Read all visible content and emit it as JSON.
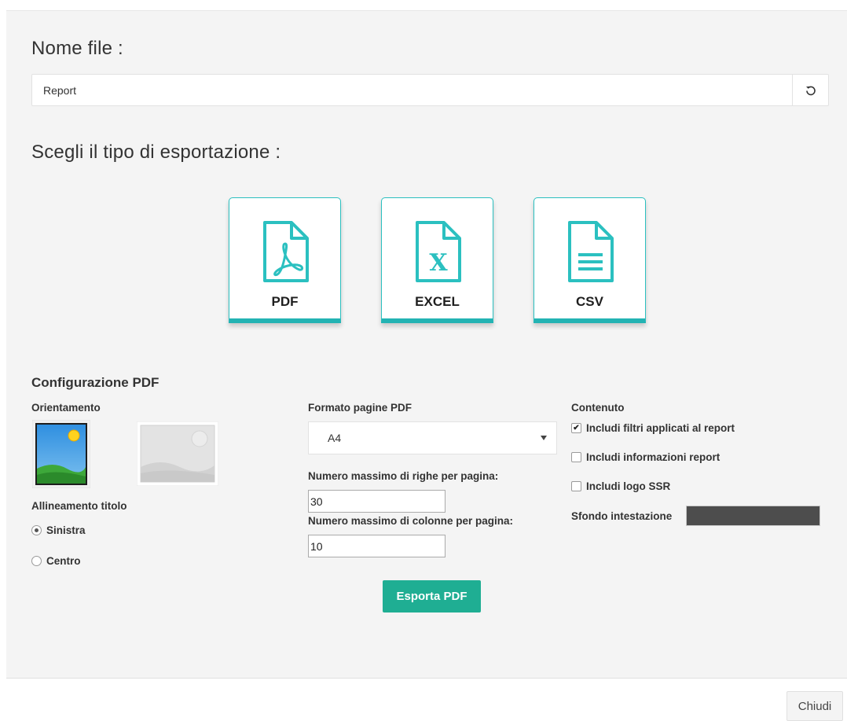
{
  "filename": {
    "heading": "Nome file :",
    "value": "Report",
    "reset_icon": "undo-icon"
  },
  "export": {
    "heading": "Scegli il tipo di esportazione :",
    "types": [
      {
        "label": "PDF",
        "icon": "pdf-file-icon"
      },
      {
        "label": "EXCEL",
        "icon": "excel-file-icon"
      },
      {
        "label": "CSV",
        "icon": "csv-file-icon"
      }
    ],
    "accent_color": "#23b3b3"
  },
  "config": {
    "title": "Configurazione PDF",
    "orientation": {
      "label": "Orientamento",
      "options": [
        {
          "name": "portrait",
          "selected": true
        },
        {
          "name": "landscape",
          "selected": false
        }
      ]
    },
    "alignment": {
      "label": "Allineamento titolo",
      "options": [
        {
          "label": "Sinistra",
          "selected": true
        },
        {
          "label": "Centro",
          "selected": false
        }
      ]
    },
    "format": {
      "label": "Formato pagine PDF",
      "value": "A4"
    },
    "max_rows": {
      "label": "Numero massimo di righe per pagina:",
      "value": "30"
    },
    "max_cols": {
      "label": "Numero massimo di colonne per pagina:",
      "value": "10"
    },
    "content": {
      "label": "Contenuto",
      "options": [
        {
          "label": "Includi filtri applicati al report",
          "checked": true
        },
        {
          "label": "Includi informazioni report",
          "checked": false
        },
        {
          "label": "Includi logo SSR",
          "checked": false
        }
      ]
    },
    "header_bg": {
      "label": "Sfondo intestazione",
      "color": "#4d4d4d"
    },
    "submit_label": "Esporta PDF",
    "submit_color": "#1fae93"
  },
  "footer": {
    "close_label": "Chiudi"
  }
}
